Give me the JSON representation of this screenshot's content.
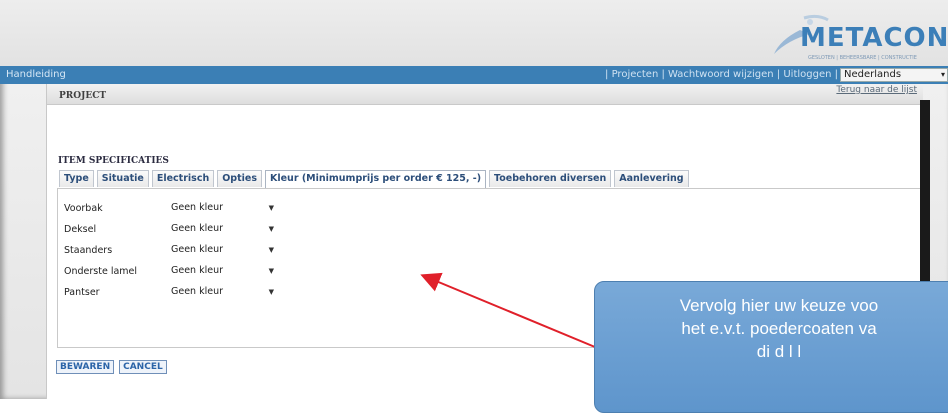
{
  "header": {
    "logo_text": "METACON",
    "logo_subtext": "GESLOTEN | BEHEERSBARE | CONSTRUCTIE"
  },
  "nav": {
    "left_link": "Handleiding",
    "right_links": "| Projecten | Wachtwoord wijzigen | Uitloggen |",
    "language": "Nederlands"
  },
  "panel": {
    "title": "PROJECT",
    "back_link": "Terug naar de lijst",
    "section_title": "ITEM SPECIFICATIES"
  },
  "tabs": [
    {
      "label": "Type"
    },
    {
      "label": "Situatie"
    },
    {
      "label": "Electrisch"
    },
    {
      "label": "Opties"
    },
    {
      "label": "Kleur (Minimumprijs per order € 125, -)",
      "active": true
    },
    {
      "label": "Toebehoren diversen"
    },
    {
      "label": "Aanlevering"
    }
  ],
  "form": {
    "rows": [
      {
        "label": "Voorbak",
        "value": "Geen kleur"
      },
      {
        "label": "Deksel",
        "value": "Geen kleur"
      },
      {
        "label": "Staanders",
        "value": "Geen kleur"
      },
      {
        "label": "Onderste lamel",
        "value": "Geen kleur"
      },
      {
        "label": "Pantser",
        "value": "Geen kleur"
      }
    ]
  },
  "buttons": {
    "save": "BEWAREN",
    "cancel": "CANCEL"
  },
  "callout": {
    "line1": "Vervolg hier uw keuze voo",
    "line2": "het e.v.t. poedercoaten va",
    "line3": "di                    d  l     l"
  },
  "colors": {
    "nav_bar": "#3b7fb5",
    "tab_text": "#2c4e7a",
    "callout_fill": "#6a9fd2",
    "arrow": "#e0202a"
  }
}
